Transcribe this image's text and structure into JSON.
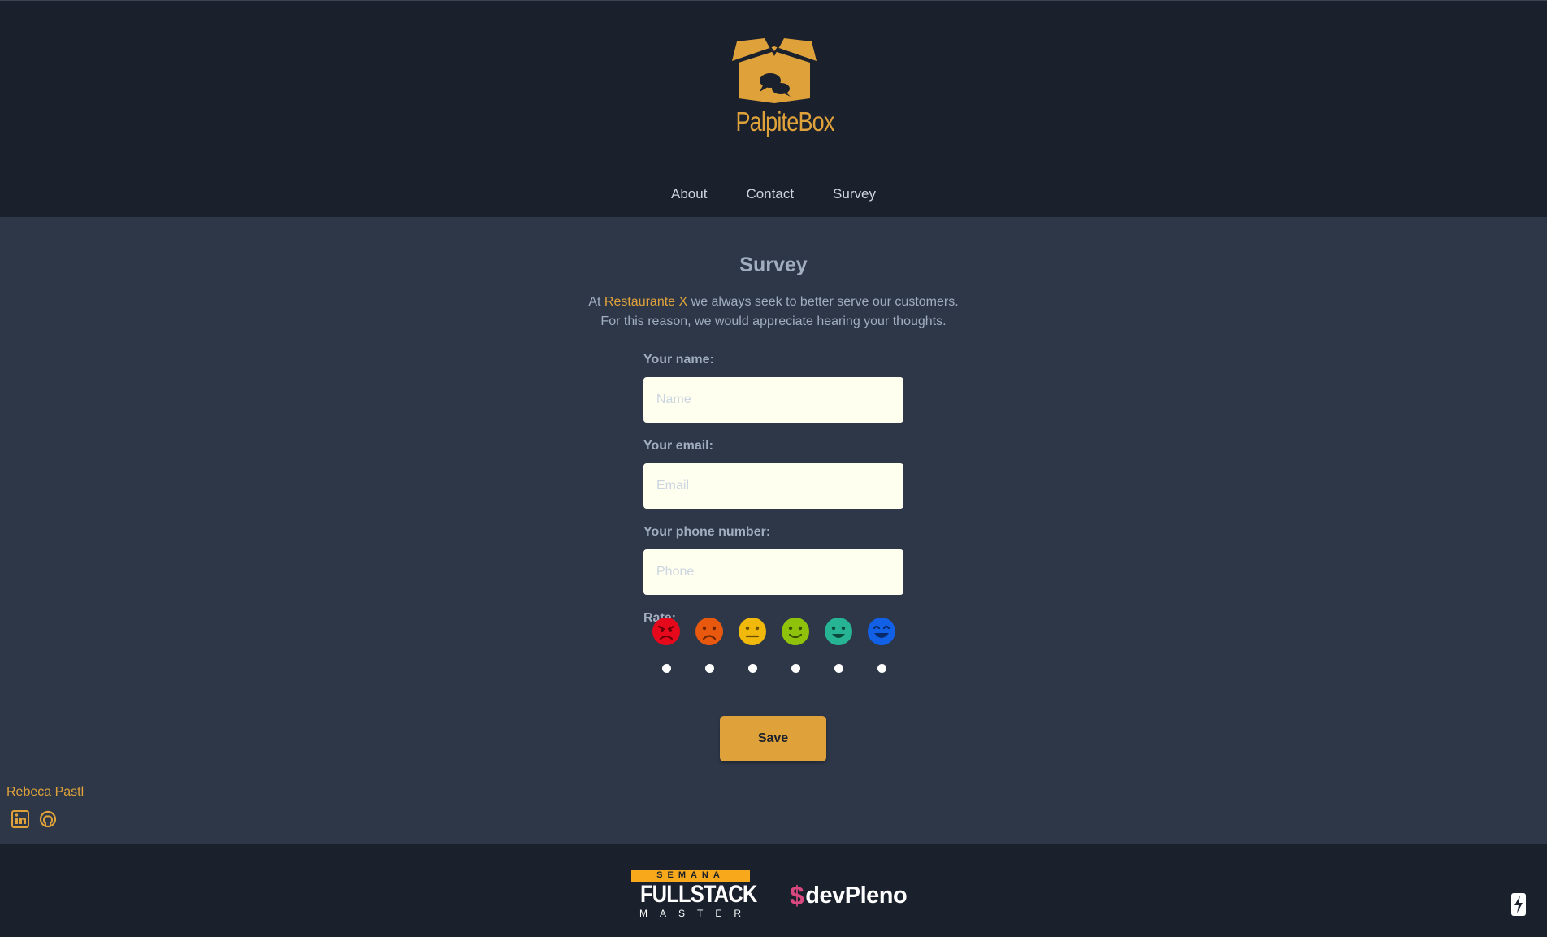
{
  "header": {
    "logo_text": "PalpiteBox",
    "nav": [
      {
        "label": "About"
      },
      {
        "label": "Contact"
      },
      {
        "label": "Survey"
      }
    ]
  },
  "main": {
    "title": "Survey",
    "intro_prefix": "At ",
    "intro_brand": "Restaurante X",
    "intro_suffix": " we always seek to better serve our customers.",
    "intro_line2": "For this reason, we would appreciate hearing your thoughts.",
    "form": {
      "name_label": "Your name:",
      "name_placeholder": "Name",
      "name_value": "",
      "email_label": "Your email:",
      "email_placeholder": "Email",
      "email_value": "",
      "phone_label": "Your phone number:",
      "phone_placeholder": "Phone",
      "phone_value": "",
      "rate_label": "Rate:",
      "rate_options": [
        {
          "icon": "angry-face-icon",
          "color": "#e5091b"
        },
        {
          "icon": "frowning-face-icon",
          "color": "#e8580f"
        },
        {
          "icon": "neutral-face-icon",
          "color": "#f0b90b"
        },
        {
          "icon": "slightly-smiling-face-icon",
          "color": "#8fc30b"
        },
        {
          "icon": "smiling-face-icon",
          "color": "#26b494"
        },
        {
          "icon": "grinning-face-icon",
          "color": "#1160e6"
        }
      ],
      "save_label": "Save"
    },
    "author": "Rebeca Pastl",
    "social": [
      {
        "icon": "linkedin-icon"
      },
      {
        "icon": "github-icon"
      }
    ]
  },
  "footer": {
    "fsm_top": "SEMANA",
    "fsm_mid": "FULLSTACK",
    "fsm_bot": "MASTER",
    "devpleno_symbol": "$",
    "devpleno_text": "devPleno"
  },
  "colors": {
    "accent": "#dfa23b",
    "header_bg": "#1a202c",
    "body_bg": "#2d3748",
    "input_bg": "#fffff0"
  }
}
